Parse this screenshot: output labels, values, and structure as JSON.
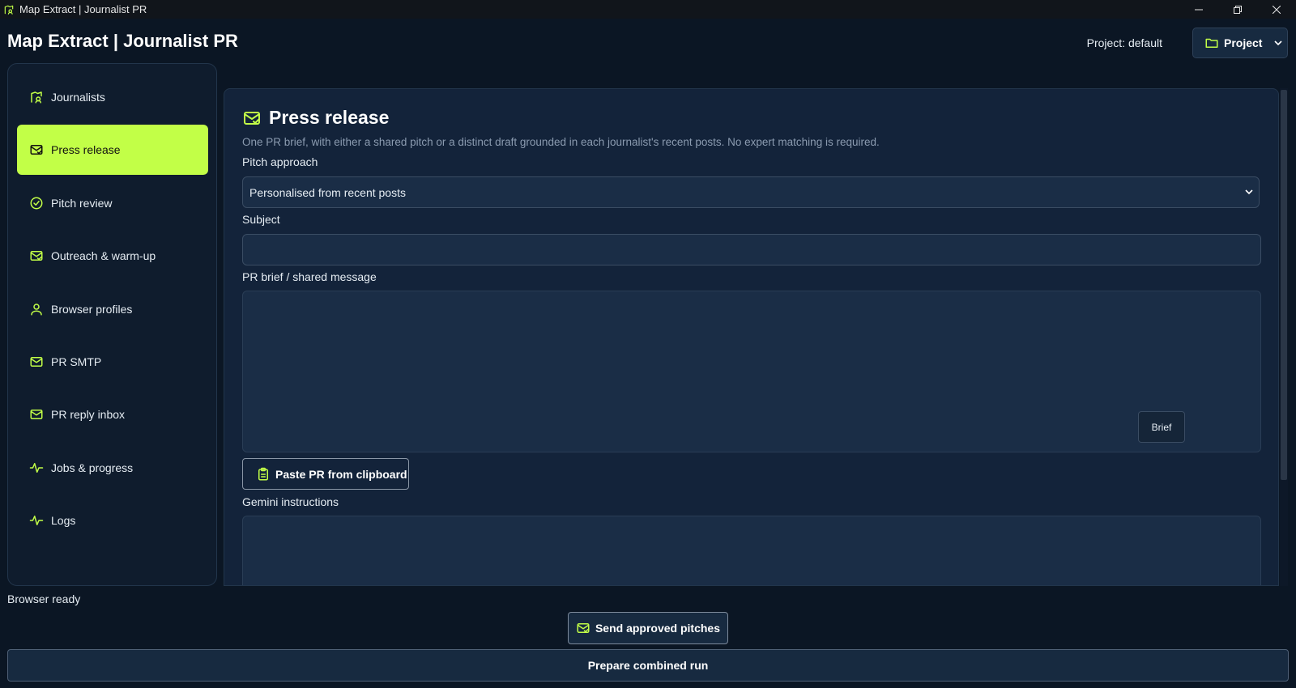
{
  "window": {
    "title": "Map Extract | Journalist PR",
    "controls": [
      "minimize",
      "restore",
      "close"
    ]
  },
  "header": {
    "app_title": "Map Extract | Journalist PR",
    "project_label": "Project: default",
    "project_button": "Project"
  },
  "sidebar": {
    "items": [
      {
        "label": "Journalists",
        "icon": "journalist-icon",
        "active": false
      },
      {
        "label": "Press release",
        "icon": "mail-check-icon",
        "active": true
      },
      {
        "label": "Pitch review",
        "icon": "check-circle-icon",
        "active": false
      },
      {
        "label": "Outreach & warm-up",
        "icon": "mail-check-icon",
        "active": false
      },
      {
        "label": "Browser profiles",
        "icon": "user-icon",
        "active": false
      },
      {
        "label": "PR SMTP",
        "icon": "mail-icon",
        "active": false
      },
      {
        "label": "PR reply inbox",
        "icon": "mail-icon",
        "active": false
      },
      {
        "label": "Jobs & progress",
        "icon": "activity-icon",
        "active": false
      },
      {
        "label": "Logs",
        "icon": "activity-icon",
        "active": false
      }
    ]
  },
  "main": {
    "title": "Press release",
    "description": "One PR brief, with either a shared pitch or a distinct draft grounded in each journalist's recent posts. No expert matching is required.",
    "pitch_approach": {
      "label": "Pitch approach",
      "value": "Personalised from recent posts"
    },
    "subject": {
      "label": "Subject",
      "value": ""
    },
    "brief": {
      "label": "PR brief / shared message",
      "value": "",
      "button": "Brief"
    },
    "paste_button": "Paste PR from clipboard",
    "gemini": {
      "label": "Gemini instructions",
      "value": ""
    }
  },
  "footer": {
    "status": "Browser ready",
    "send_button": "Send approved pitches",
    "prepare_button": "Prepare combined run"
  },
  "colors": {
    "accent": "#c2ff47",
    "background": "#0b1624",
    "panel": "#13233a",
    "field": "#1a2d46"
  }
}
